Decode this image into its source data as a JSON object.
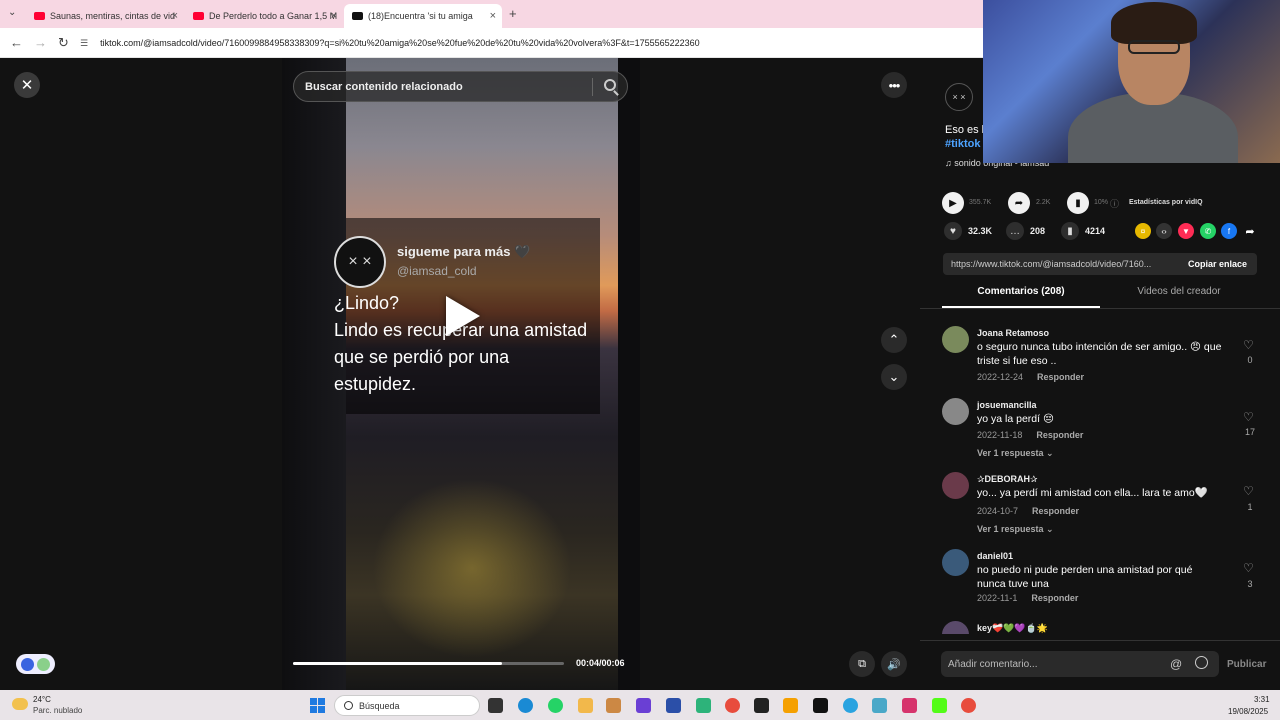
{
  "browser": {
    "tabs": [
      {
        "title": "Saunas, mentiras, cintas de vid",
        "icon": "youtube-icon"
      },
      {
        "title": "De Perderlo todo a Ganar 1,5 M",
        "icon": "youtube-icon"
      },
      {
        "title": "(18)Encuentra 'si tu amiga",
        "icon": "tiktok-icon"
      }
    ],
    "new_tab": "+",
    "url": "tiktok.com/@iamsadcold/video/7160099884958338309?q=si%20tu%20amiga%20se%20fue%20de%20tu%20vida%20volvera%3F&t=1755565222360"
  },
  "player": {
    "search_placeholder": "Buscar contenido relacionado",
    "close": "✕",
    "more": "•••",
    "up": "⌃",
    "down": "⌄",
    "time": "00:04/00:06",
    "progress_fraction": 0.77,
    "volume_icon": "speaker-icon",
    "overlay": {
      "name": "sigueme para más 🖤",
      "handle": "@iamsad_cold",
      "text": "¿Lindo?\nLindo es recuperar una amistad que se perdió por una estupidez."
    }
  },
  "panel": {
    "description": "Eso es l",
    "hashtag": "#tiktok",
    "sound": "♫  sonido original - iamsad",
    "stats": {
      "plays": "355.7K",
      "shares": "2.2K",
      "ratio": "10%",
      "vidiq_label": "Estadísticas por vidIQ",
      "likes": "32.3K",
      "comments": "208",
      "saves": "4214"
    },
    "link": "https://www.tiktok.com/@iamsadcold/video/7160...",
    "copy_link": "Copiar enlace",
    "tabs": {
      "comments": "Comentarios (208)",
      "creator": "Videos del creador"
    },
    "comments": [
      {
        "user": "Joana Retamoso",
        "text": "o seguro nunca tubo intención de ser amigo.. 😠 que triste si fue eso ..",
        "date": "2022-12-24",
        "reply": "Responder",
        "likes": "0",
        "more": ""
      },
      {
        "user": "josuemancilla",
        "text": "yo ya la perdí 😔",
        "date": "2022-11-18",
        "reply": "Responder",
        "likes": "17",
        "more": "Ver 1 respuesta ⌄"
      },
      {
        "user": "✰DEBORAH✰",
        "text": "yo... ya perdí mi amistad con ella... lara te amo🤍",
        "date": "2024-10-7",
        "reply": "Responder",
        "likes": "1",
        "more": "Ver 1 respuesta ⌄"
      },
      {
        "user": "daniel01",
        "text": "no puedo ni pude perden una amistad por qué nunca tuve una",
        "date": "2022-11-1",
        "reply": "Responder",
        "likes": "3",
        "more": ""
      },
      {
        "user": "key❤️‍🩹💚💜🍵🌟",
        "text": "",
        "date": "",
        "reply": "",
        "likes": "",
        "more": ""
      }
    ],
    "comment_placeholder": "Añadir comentario...",
    "mention": "@",
    "publish": "Publicar"
  },
  "taskbar": {
    "temp": "24°C",
    "weather": "Parc. nublado",
    "search": "Búsqueda",
    "time": "3:31",
    "date": "19/08/2025"
  },
  "colors": {
    "accent": "#fe2c55",
    "link": "#4da3ff",
    "tabbar": "#f7d7e3"
  }
}
